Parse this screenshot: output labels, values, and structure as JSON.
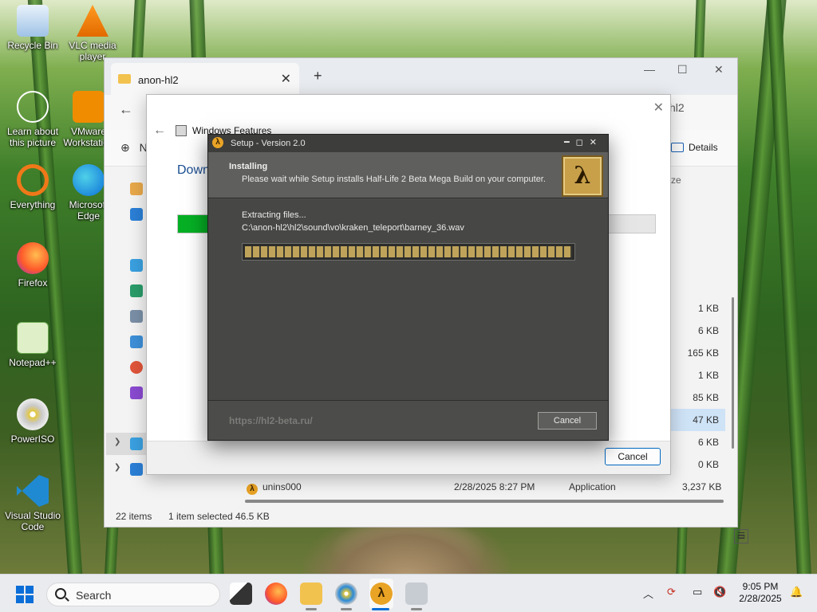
{
  "desktop": {
    "icons": [
      {
        "label": "Recycle Bin"
      },
      {
        "label": "VLC media player"
      },
      {
        "label": "Learn about this picture"
      },
      {
        "label": "VMware Workstation"
      },
      {
        "label": "Everything"
      },
      {
        "label": "Microsoft Edge"
      },
      {
        "label": "Firefox"
      },
      {
        "label": "Notepad++"
      },
      {
        "label": "PowerISO"
      },
      {
        "label": "Visual Studio Code"
      }
    ]
  },
  "explorer": {
    "tab_title": "anon-hl2",
    "new_tab": "+",
    "search_fragment": "hl2",
    "new_button_fragment": "N",
    "details_label": "Details",
    "size_header": "ze",
    "file_sizes": [
      "1 KB",
      "6 KB",
      "165 KB",
      "1 KB",
      "85 KB",
      "47 KB",
      "6 KB",
      "0 KB"
    ],
    "visible_row": {
      "name": "unins000",
      "date": "2/28/2025 8:27 PM",
      "type": "Application",
      "size": "3,237 KB"
    },
    "status": {
      "items": "22 items",
      "selected": "1 item selected",
      "size": "46.5 KB"
    }
  },
  "features_dialog": {
    "title": "Windows Features",
    "heading_fragment": "Down",
    "progress": 0.07,
    "cancel_label": "Cancel"
  },
  "setup": {
    "title": "Setup - Version 2.0",
    "header_title": "Installing",
    "header_sub": "Please wait while Setup installs Half-Life 2 Beta Mega Build on your computer.",
    "logo": "λ",
    "status_line": "Extracting files...",
    "file_path": "C:\\anon-hl2\\hl2\\sound\\vo\\kraken_teleport\\barney_36.wav",
    "progress": 1.0,
    "url": "https://hl2-beta.ru/",
    "cancel_label": "Cancel"
  },
  "taskbar": {
    "search_placeholder": "Search",
    "time": "9:05 PM",
    "date": "2/28/2025"
  }
}
